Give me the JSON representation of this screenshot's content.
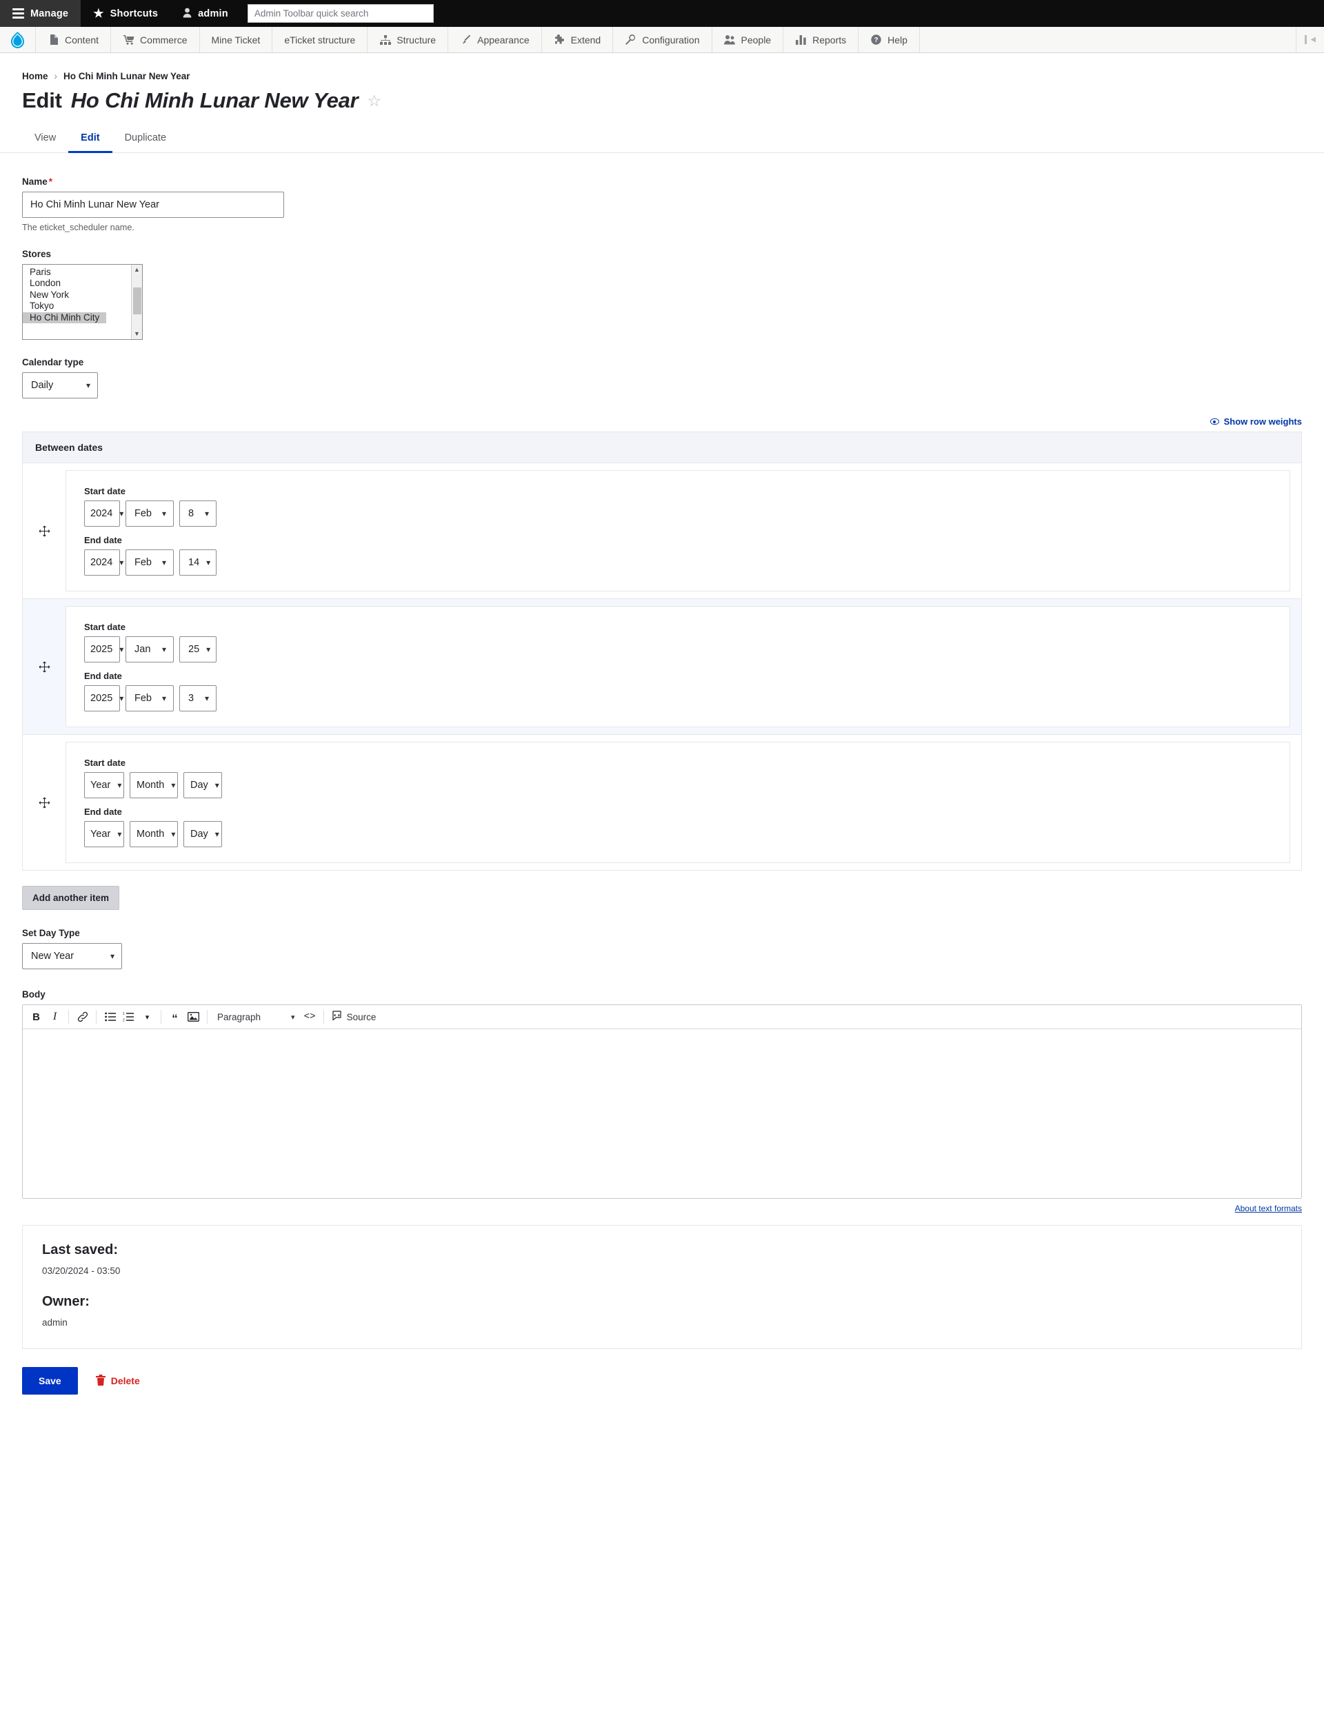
{
  "admin_toolbar": {
    "manage": "Manage",
    "shortcuts": "Shortcuts",
    "user": "admin",
    "search_placeholder": "Admin Toolbar quick search"
  },
  "menu": {
    "items": [
      {
        "label": "Content",
        "icon": "page-icon"
      },
      {
        "label": "Commerce",
        "icon": "cart-icon"
      },
      {
        "label": "Mine Ticket",
        "icon": ""
      },
      {
        "label": "eTicket structure",
        "icon": ""
      },
      {
        "label": "Structure",
        "icon": "sitemap-icon"
      },
      {
        "label": "Appearance",
        "icon": "brush-icon"
      },
      {
        "label": "Extend",
        "icon": "puzzle-icon"
      },
      {
        "label": "Configuration",
        "icon": "wrench-icon"
      },
      {
        "label": "People",
        "icon": "people-icon"
      },
      {
        "label": "Reports",
        "icon": "bars-icon"
      },
      {
        "label": "Help",
        "icon": "question-icon"
      }
    ]
  },
  "breadcrumb": {
    "home": "Home",
    "separator": "›",
    "current": "Ho Chi Minh Lunar New Year"
  },
  "page": {
    "title_prefix": "Edit",
    "title_entity": "Ho Chi Minh Lunar New Year"
  },
  "tabs": [
    {
      "label": "View",
      "active": false
    },
    {
      "label": "Edit",
      "active": true
    },
    {
      "label": "Duplicate",
      "active": false
    }
  ],
  "form": {
    "name": {
      "label": "Name",
      "required_mark": "*",
      "value": "Ho Chi Minh Lunar New Year",
      "description": "The eticket_scheduler name."
    },
    "stores": {
      "label": "Stores",
      "options": [
        "Paris",
        "London",
        "New York",
        "Tokyo",
        "Ho Chi Minh City"
      ],
      "selected": "Ho Chi Minh City"
    },
    "calendar_type": {
      "label": "Calendar type",
      "value": "Daily"
    },
    "show_row_weights": "Show row weights",
    "between_dates": {
      "title": "Between dates",
      "start_label": "Start date",
      "end_label": "End date",
      "rows": [
        {
          "start": {
            "year": "2024",
            "month": "Feb",
            "day": "8"
          },
          "end": {
            "year": "2024",
            "month": "Feb",
            "day": "14"
          }
        },
        {
          "start": {
            "year": "2025",
            "month": "Jan",
            "day": "25"
          },
          "end": {
            "year": "2025",
            "month": "Feb",
            "day": "3"
          }
        },
        {
          "start": {
            "year": "Year",
            "month": "Month",
            "day": "Day"
          },
          "end": {
            "year": "Year",
            "month": "Month",
            "day": "Day"
          }
        }
      ],
      "add_another": "Add another item"
    },
    "set_day_type": {
      "label": "Set Day Type",
      "value": "New Year"
    },
    "body": {
      "label": "Body",
      "toolbar": {
        "bold": "B",
        "italic": "I",
        "link": "link-icon",
        "bulleted_list": "bulleted-list-icon",
        "numbered_list": "numbered-list-icon",
        "list_dropdown": "chevron-down-icon",
        "block_quote": "quote-icon",
        "image": "image-icon",
        "paragraph_style": "Paragraph",
        "code": "<>",
        "source": "Source"
      },
      "content": "",
      "about_text_formats": "About text formats"
    }
  },
  "meta": {
    "last_saved_label": "Last saved:",
    "last_saved_value": "03/20/2024 - 03:50",
    "owner_label": "Owner:",
    "owner_value": "admin"
  },
  "actions": {
    "save": "Save",
    "delete": "Delete"
  },
  "colors": {
    "accent": "#0034c4",
    "danger": "#d72222",
    "toolbar_bg": "#0d0d0d",
    "menu_bg": "#f7f7f5"
  }
}
